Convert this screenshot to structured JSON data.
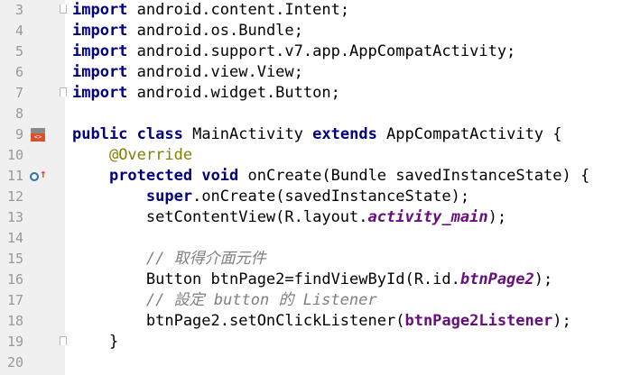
{
  "editor": {
    "line_numbers": [
      "3",
      "4",
      "5",
      "6",
      "7",
      "8",
      "9",
      "10",
      "11",
      "12",
      "13",
      "14",
      "15",
      "16",
      "17",
      "18",
      "19",
      "20"
    ],
    "gutter_icons": {
      "run_icon": "run-activity-icon",
      "override_icon": "implements-method-icon"
    },
    "lines": [
      [
        {
          "t": "import",
          "c": "kw"
        },
        {
          "t": " android.content.Intent;"
        }
      ],
      [
        {
          "t": "import",
          "c": "kw"
        },
        {
          "t": " android.os.Bundle;"
        }
      ],
      [
        {
          "t": "import",
          "c": "kw"
        },
        {
          "t": " android.support.v7.app.AppCompatActivity;"
        }
      ],
      [
        {
          "t": "import",
          "c": "kw"
        },
        {
          "t": " android.view.View;"
        }
      ],
      [
        {
          "t": "import",
          "c": "kw"
        },
        {
          "t": " android.widget.Button;"
        }
      ],
      [],
      [
        {
          "t": "public",
          "c": "kw"
        },
        {
          "t": " "
        },
        {
          "t": "class",
          "c": "kw"
        },
        {
          "t": " MainActivity "
        },
        {
          "t": "extends",
          "c": "kw"
        },
        {
          "t": " AppCompatActivity {"
        }
      ],
      [
        {
          "t": "    "
        },
        {
          "t": "@Override",
          "c": "ann"
        }
      ],
      [
        {
          "t": "    "
        },
        {
          "t": "protected",
          "c": "kw"
        },
        {
          "t": " "
        },
        {
          "t": "void",
          "c": "kw"
        },
        {
          "t": " onCreate(Bundle savedInstanceState) {"
        }
      ],
      [
        {
          "t": "        "
        },
        {
          "t": "super",
          "c": "kw"
        },
        {
          "t": ".onCreate(savedInstanceState);"
        }
      ],
      [
        {
          "t": "        setContentView(R.layout."
        },
        {
          "t": "activity_main",
          "c": "field"
        },
        {
          "t": ");"
        }
      ],
      [],
      [
        {
          "t": "        "
        },
        {
          "t": "// 取得介面元件",
          "c": "cmt"
        }
      ],
      [
        {
          "t": "        Button btnPage2=findViewById(R.id."
        },
        {
          "t": "btnPage2",
          "c": "field"
        },
        {
          "t": ");"
        }
      ],
      [
        {
          "t": "        "
        },
        {
          "t": "// 設定 button 的 Listener",
          "c": "cmt"
        }
      ],
      [
        {
          "t": "        btnPage2.setOnClickListener("
        },
        {
          "t": "btnPage2Listener",
          "c": "boldid"
        },
        {
          "t": ");"
        }
      ],
      [
        {
          "t": "    }"
        }
      ],
      []
    ]
  },
  "colors": {
    "keyword": "#000080",
    "annotation": "#808000",
    "field": "#660e7a",
    "comment": "#808080",
    "gutter_bg": "#f0f0f0"
  }
}
